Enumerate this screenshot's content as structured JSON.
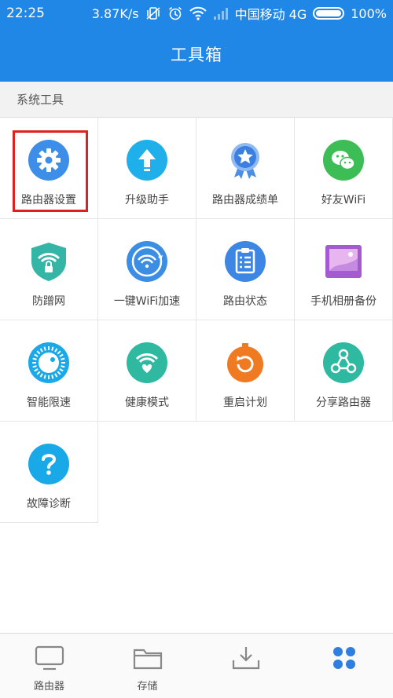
{
  "status_bar": {
    "time": "22:25",
    "speed": "3.87K/s",
    "carrier": "中国移动 4G",
    "battery_text": "100%",
    "battery_level": 1.0
  },
  "header": {
    "title": "工具箱"
  },
  "section": {
    "title": "系统工具"
  },
  "tools": [
    {
      "label": "路由器设置",
      "icon": "gear-icon",
      "color": "#3d8ee8"
    },
    {
      "label": "升级助手",
      "icon": "upgrade-arrow-icon",
      "color": "#1fb0ec"
    },
    {
      "label": "路由器成绩单",
      "icon": "medal-star-icon",
      "color": "#3b7fe0"
    },
    {
      "label": "好友WiFi",
      "icon": "chat-bubble-icon",
      "color": "#3cbd55"
    },
    {
      "label": "防蹭网",
      "icon": "wifi-shield-icon",
      "color": "#35b5a5"
    },
    {
      "label": "一键WiFi加速",
      "icon": "wifi-speed-icon",
      "color": "#3b8ee4"
    },
    {
      "label": "路由状态",
      "icon": "clipboard-list-icon",
      "color": "#3d86e4"
    },
    {
      "label": "手机相册备份",
      "icon": "photo-album-icon",
      "color": "#a45bd0"
    },
    {
      "label": "智能限速",
      "icon": "speed-dial-icon",
      "color": "#1aa9e8"
    },
    {
      "label": "健康模式",
      "icon": "heart-wifi-icon",
      "color": "#2fb9a0"
    },
    {
      "label": "重启计划",
      "icon": "restart-timer-icon",
      "color": "#f07a22"
    },
    {
      "label": "分享路由器",
      "icon": "share-icon",
      "color": "#2fb9a0"
    },
    {
      "label": "故障诊断",
      "icon": "question-icon",
      "color": "#1aa9e8"
    }
  ],
  "bottom_nav": [
    {
      "label": "路由器",
      "icon": "monitor-icon"
    },
    {
      "label": "存储",
      "icon": "folder-icon"
    },
    {
      "label": "",
      "icon": "download-tray-icon"
    },
    {
      "label": "",
      "icon": "apps-dots-icon"
    }
  ],
  "colors": {
    "primary": "#2187e6",
    "selection": "#e02020"
  }
}
